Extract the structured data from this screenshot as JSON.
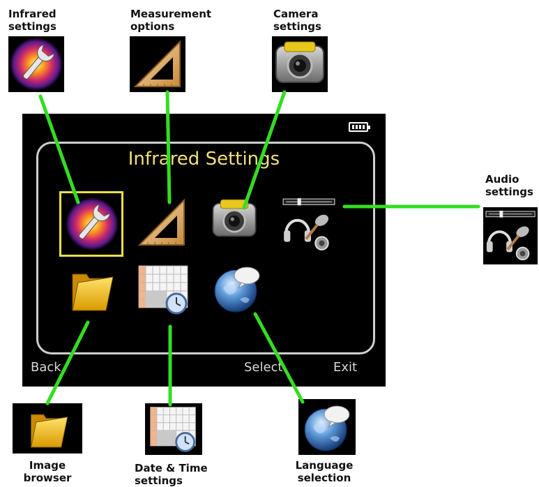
{
  "device_screen": {
    "title": "Infrared Settings",
    "softkeys": {
      "back": "Back",
      "select": "Select",
      "exit": "Exit"
    },
    "selected_item": "infrared-settings"
  },
  "callouts": {
    "infrared": "Infrared\nsettings",
    "measurement": "Measurement\noptions",
    "camera": "Camera\nsettings",
    "audio": "Audio\nsettings",
    "image_browser": "Image\nbrowser",
    "date_time": "Date & Time\nsettings",
    "language": "Language\nselection"
  },
  "colors": {
    "connector": "#33dd22",
    "title": "#f2e07a",
    "selection": "#e8e04a",
    "screen_bg": "#000000"
  },
  "icons": [
    "wrench-thermal-icon",
    "set-square-icon",
    "camera-icon",
    "headset-microphone-icon",
    "folder-icon",
    "calendar-clock-icon",
    "globe-speech-icon"
  ]
}
